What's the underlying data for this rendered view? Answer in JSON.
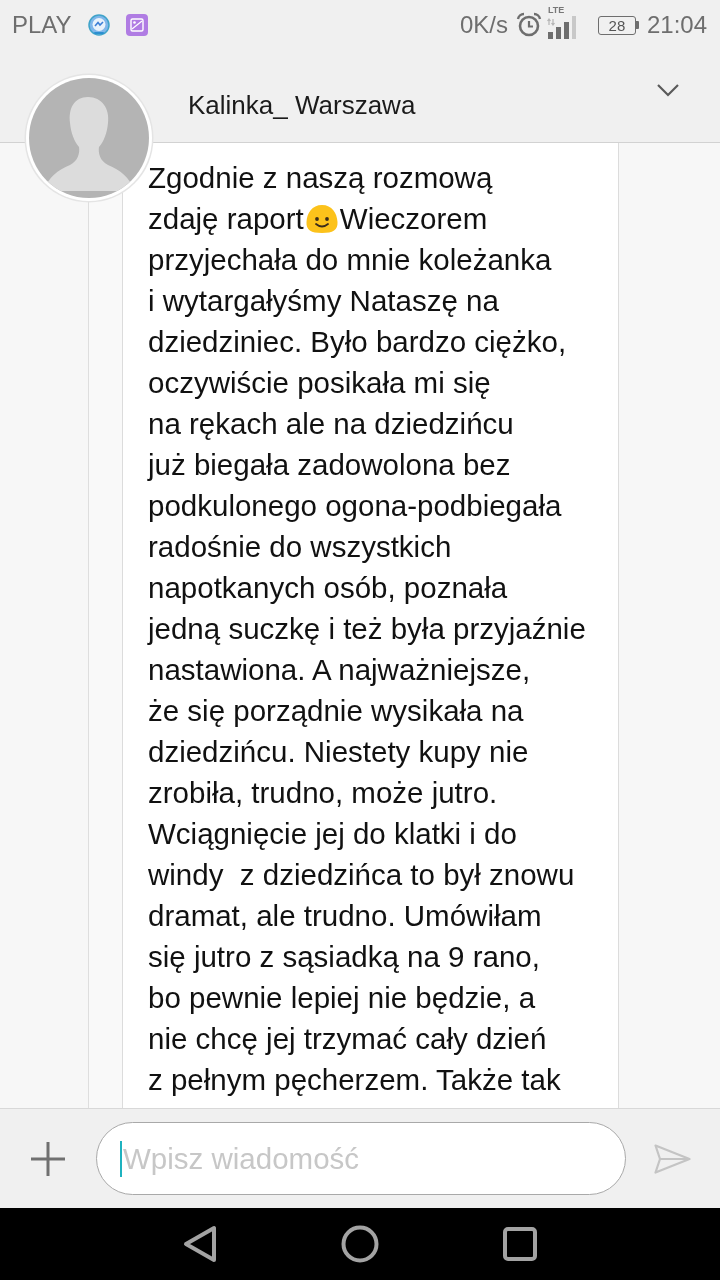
{
  "status_bar": {
    "carrier": "PLAY",
    "network_speed": "0K/s",
    "network_type": "LTE",
    "battery": "28",
    "time": "21:04"
  },
  "chat_header": {
    "contact_name": "Kalinka_ Warszawa"
  },
  "message": {
    "parts": [
      {
        "kind": "text",
        "text": "Zgodnie z naszą rozmową"
      },
      {
        "kind": "text",
        "text": "zdaję raport"
      },
      {
        "kind": "emoji"
      },
      {
        "kind": "text",
        "text": "Wieczorem"
      },
      {
        "kind": "text",
        "text": "przyjechała do mnie koleżanka\ni wytargałyśmy Nataszę na\ndziedziniec. Było bardzo ciężko,\noczywiście posikała mi się\nna rękach ale na dziedzińcu\njuż biegała zadowolona bez\npodkulonego ogona-podbiegała\nradośnie do wszystkich\nnapotkanych osób, poznała\njedną suczkę i też była przyjaźnie\nnastawiona. A najważniejsze,\nże się porządnie wysikała na\ndziedzińcu. Niestety kupy nie\nzrobiła, trudno, może jutro.\nWciągnięcie jej do klatki i do\nwindy  z dziedzińca to był znowu\ndramat, ale trudno. Umówiłam\nsię jutro z sąsiadką na 9 rano,\nbo pewnie lepiej nie będzie, a\nnie chcę jej trzymać cały dzień\nz pełnym pęcherzem. Także tak"
      }
    ]
  },
  "composer": {
    "placeholder": "Wpisz wiadomość"
  }
}
